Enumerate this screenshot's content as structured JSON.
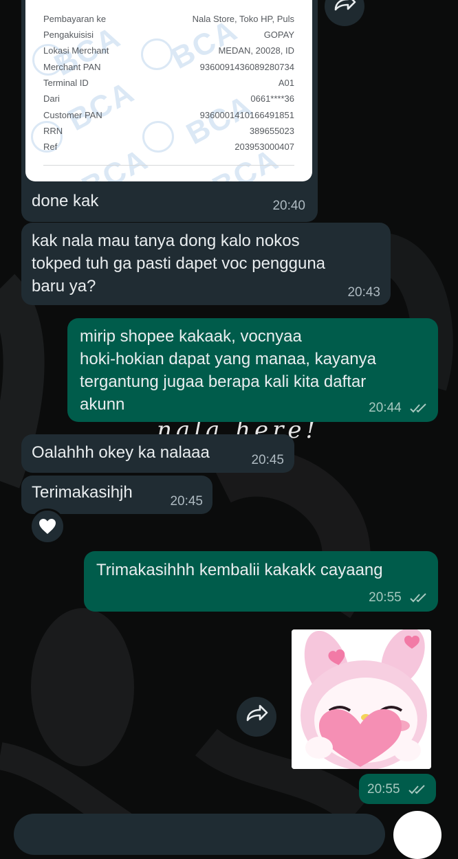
{
  "receipt": {
    "rows": [
      {
        "label": "Pembayaran ke",
        "value": "Nala Store, Toko HP, Puls"
      },
      {
        "label": "Pengakuisisi",
        "value": "GOPAY"
      },
      {
        "label": "Lokasi Merchant",
        "value": "MEDAN, 20028, ID"
      },
      {
        "label": "Merchant PAN",
        "value": "9360091436089280734"
      },
      {
        "label": "Terminal ID",
        "value": "A01"
      },
      {
        "label": "Dari",
        "value": "0661****36"
      },
      {
        "label": "Customer PAN",
        "value": "9360001410166491851"
      },
      {
        "label": "RRN",
        "value": "389655023"
      },
      {
        "label": "Ref",
        "value": "203953000407"
      }
    ],
    "watermark": "BCA"
  },
  "messages": [
    {
      "text": "done kak",
      "time": "20:40",
      "direction": "incoming"
    },
    {
      "text": "kak nala mau tanya dong kalo nokos\ntokped tuh ga pasti dapet voc pengguna\nbaru ya?",
      "time": "20:43",
      "direction": "incoming"
    },
    {
      "text": "mirip shopee kakaak, vocnyaa\nhoki-hokian dapat yang manaa, kayanya\ntergantung jugaa berapa kali kita daftar\nakunn",
      "time": "20:44",
      "direction": "outgoing"
    },
    {
      "text": "Oalahhh okey ka nalaaa",
      "time": "20:45",
      "direction": "incoming"
    },
    {
      "text": "Terimakasihjh",
      "time": "20:45",
      "direction": "incoming",
      "reaction": "white-heart"
    },
    {
      "text": "Trimakasihhh kembalii kakakk cayaang",
      "time": "20:55",
      "direction": "outgoing"
    },
    {
      "text": "",
      "time": "20:55",
      "direction": "outgoing",
      "kind": "sticker",
      "sticker": "pink bunny hugging heart"
    }
  ],
  "wallpaper_text": "nala here!",
  "colors": {
    "background": "#0b0c0c",
    "incoming_bubble": "#202c33",
    "outgoing_bubble": "#005c4b",
    "text": "#e9edef",
    "read_ticks": "#a8c9c0"
  },
  "icons": {
    "forward": "forward-icon",
    "read_receipt": "double-check-icon",
    "reaction": "white-heart-icon"
  }
}
